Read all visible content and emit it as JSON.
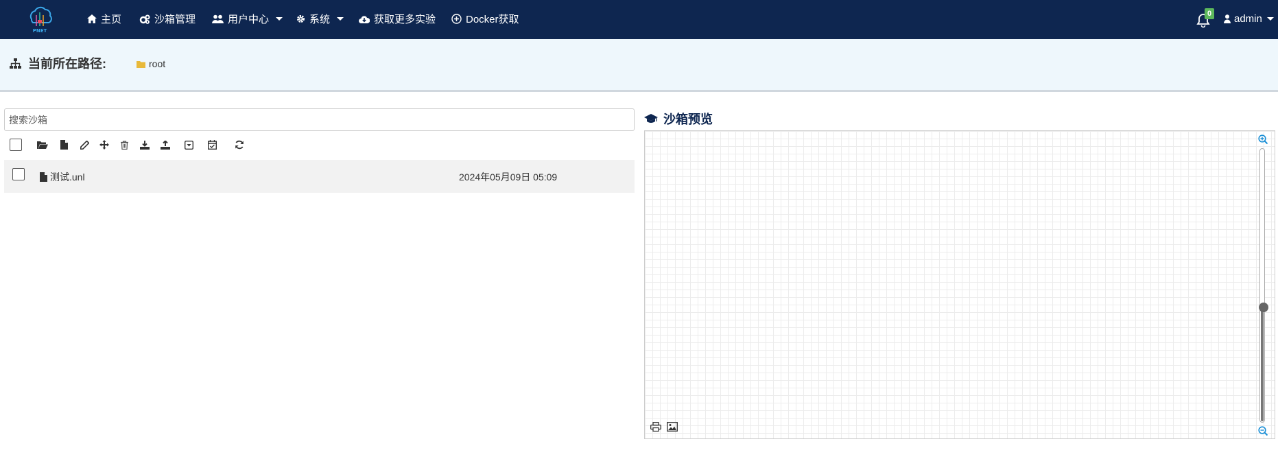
{
  "brand": {
    "logo_text": "PNET",
    "accent": "#0e2650"
  },
  "nav": {
    "items": [
      {
        "label": "主页",
        "icon": "home-icon"
      },
      {
        "label": "沙箱管理",
        "icon": "cogs-icon"
      },
      {
        "label": "用户中心",
        "icon": "users-icon",
        "dropdown": true
      },
      {
        "label": "系统",
        "icon": "gear-icon",
        "dropdown": true
      },
      {
        "label": "获取更多实验",
        "icon": "cloud-download-icon"
      },
      {
        "label": "Docker获取",
        "icon": "plus-circle-icon"
      }
    ],
    "notifications_count": "0",
    "user": "admin"
  },
  "path": {
    "title": "当前所在路径:",
    "folder": "root"
  },
  "search": {
    "placeholder": "搜索沙箱"
  },
  "toolbar": [
    "select-all",
    "open-folder-icon",
    "new-file-icon",
    "rename-icon",
    "move-icon",
    "delete-icon",
    "import-icon",
    "export-icon",
    "collapse-icon",
    "calendar-check-icon",
    "refresh-icon"
  ],
  "files": [
    {
      "name": "测试.unl",
      "date": "2024年05月09日 05:09"
    }
  ],
  "preview": {
    "title": "沙箱预览",
    "zoom_level": 0.42
  }
}
